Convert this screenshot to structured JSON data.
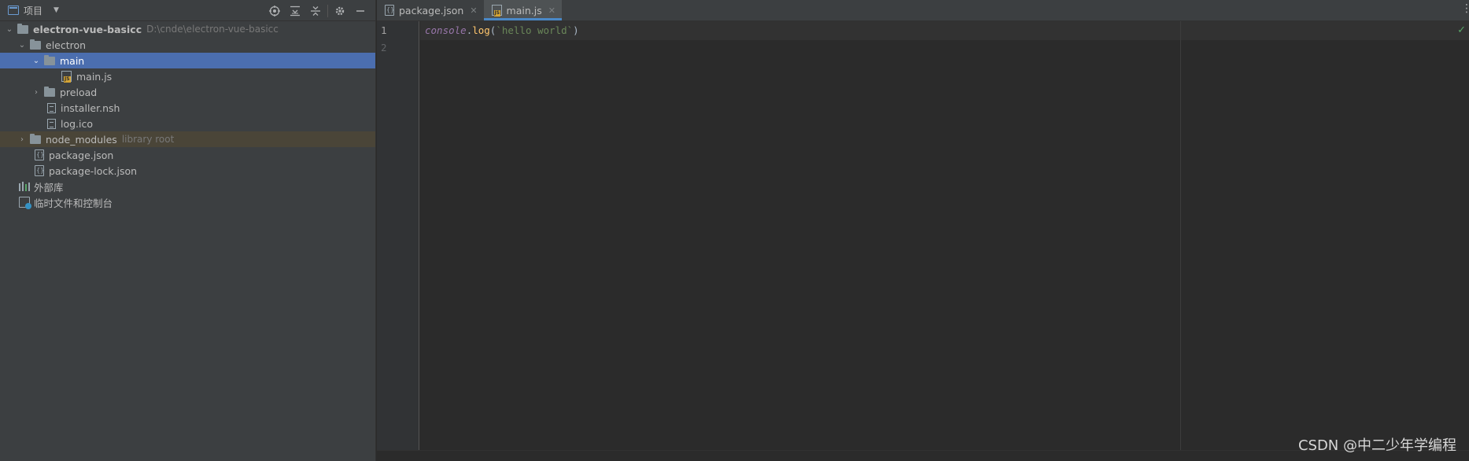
{
  "project_panel": {
    "title": "项目",
    "tree": [
      {
        "label": "electron-vue-basicc",
        "hint": "D:\\cnde\\electron-vue-basicc"
      },
      {
        "label": "electron"
      },
      {
        "label": "main"
      },
      {
        "label": "main.js"
      },
      {
        "label": "preload"
      },
      {
        "label": "installer.nsh"
      },
      {
        "label": "log.ico"
      },
      {
        "label": "node_modules",
        "hint": "library root"
      },
      {
        "label": "package.json"
      },
      {
        "label": "package-lock.json"
      },
      {
        "label": "外部库"
      },
      {
        "label": "临时文件和控制台"
      }
    ]
  },
  "editor": {
    "tabs": [
      {
        "label": "package.json",
        "active": false
      },
      {
        "label": "main.js",
        "active": true
      }
    ],
    "line_numbers": [
      "1",
      "2"
    ],
    "code": {
      "line1": {
        "obj": "console",
        "dot": ".",
        "fn": "log",
        "open": "(",
        "str": "`hello world`",
        "close": ")"
      }
    }
  },
  "watermark": "CSDN @中二少年学编程",
  "colors": {
    "selection": "#4b6eaf",
    "library_row": "#4a4538",
    "active_tab_underline": "#4a88c7",
    "string": "#6a8759",
    "function": "#ffc66d",
    "object": "#9876aa"
  }
}
